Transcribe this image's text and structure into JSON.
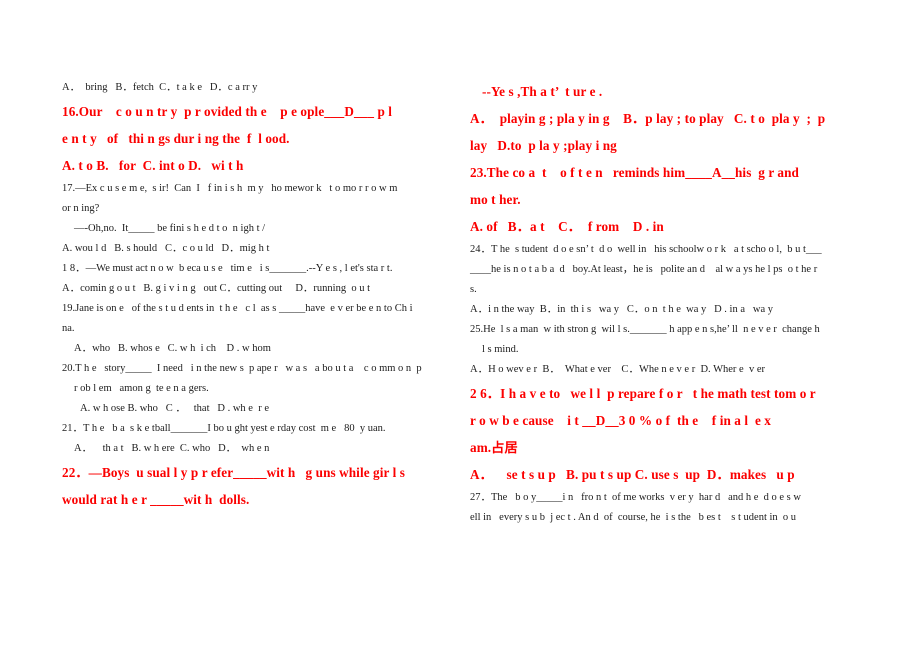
{
  "document": {
    "type": "scanned-worksheet",
    "subject": "English grammar multiple choice",
    "columns": 2,
    "colors": {
      "marked_text": "#fb0000",
      "body_text": "#1c1c1c",
      "page_background": "#ffffff"
    }
  },
  "left_column": {
    "lines": [
      {
        "id": "q15-options",
        "style": "black",
        "indent": 0,
        "text": "A．  bring   B．fetch  C．t a k e   D．c a rr y"
      },
      {
        "id": "q16-stem-1",
        "style": "red",
        "indent": 0,
        "text": "16.Our    c o u n tr y  p r ovided th e    p e ople___D___ p l"
      },
      {
        "id": "q16-stem-2",
        "style": "red",
        "indent": 0,
        "text": "e n t y   of   thi n gs dur i ng the  f  l ood."
      },
      {
        "id": "q16-options",
        "style": "red",
        "indent": 0,
        "text": "A. t o B.   for  C. int o D.   wi t h"
      },
      {
        "id": "q17-stem-1",
        "style": "black",
        "indent": 0,
        "text": "17.—Ex c u s e m e,  s ir!  Can  I   f in i s h  m y   ho mewor k   t o mo r r o w m"
      },
      {
        "id": "q17-stem-2",
        "style": "black",
        "indent": 0,
        "text": "or n ing?"
      },
      {
        "id": "q17-stem-3",
        "style": "black",
        "indent": 1,
        "text": "—-Oh,no.  It_____ be fini s h e d t o  n igh t /"
      },
      {
        "id": "q17-options",
        "style": "black",
        "indent": 0,
        "text": "A. wou l d   B. s hould   C．c o u ld   D．mig h t"
      },
      {
        "id": "q18-stem",
        "style": "black",
        "indent": 0,
        "text": "1 8．—We must act n o w  b eca u s e   tim e   i s_______.--Y e s , l et's sta r t."
      },
      {
        "id": "q18-options",
        "style": "black",
        "indent": 0,
        "text": "A．comin g o u t   B. g i v i n g   out C．cutting out     D．running  o u t"
      },
      {
        "id": "q19-stem-1",
        "style": "black",
        "indent": 0,
        "text": "19.Jane is on e   of the s t u d ents in  t h e   c l  as s _____have  e v er be e n to Ch i"
      },
      {
        "id": "q19-stem-2",
        "style": "black",
        "indent": 0,
        "text": "na."
      },
      {
        "id": "q19-options",
        "style": "black",
        "indent": 1,
        "text": "A．who   B. whos e   C. w h  i ch    D . w hom"
      },
      {
        "id": "q20-stem-1",
        "style": "black",
        "indent": 0,
        "text": "20.T h e   story_____  I need   i n the new s  p ape r   w a s   a bo u t a    c o mm o n  p"
      },
      {
        "id": "q20-stem-2",
        "style": "black",
        "indent": 1,
        "text": "r ob l em   amon g  te e n a gers."
      },
      {
        "id": "q20-options",
        "style": "black",
        "indent": 2,
        "text": "A. w h ose B. who   C ．   that   D . wh e  r e"
      },
      {
        "id": "q21-stem",
        "style": "black",
        "indent": 0,
        "text": "21．T h e   b a  s k e tball_______I bo u ght yest e rday cost  m e   80  y uan."
      },
      {
        "id": "q21-options",
        "style": "black",
        "indent": 1,
        "text": "A．    th a t   B. w h ere  C. who   D．  wh e n"
      },
      {
        "id": "q22-stem-1",
        "style": "red",
        "indent": 0,
        "text": "22．—Boys  u sual l y p r efer_____wit h   g uns while gir l s"
      },
      {
        "id": "q22-stem-2",
        "style": "red",
        "indent": 0,
        "text": "would rat h e r _____wit h  dolls."
      }
    ]
  },
  "right_column": {
    "lines": [
      {
        "id": "q22-answer",
        "style": "red",
        "indent": 1,
        "text": "--Ye s ,Th a t’  t ur e ."
      },
      {
        "id": "q22-options-1",
        "style": "red",
        "indent": 0,
        "text": "A．  playin g ; pla y in g    B．p lay ; to play   C. t o  pla y  ;  p"
      },
      {
        "id": "q22-options-2",
        "style": "red",
        "indent": 0,
        "text": "lay   D.to  p la y ;play i ng"
      },
      {
        "id": "q23-stem-1",
        "style": "red",
        "indent": 0,
        "text": "23.The co a  t    o f t e n   reminds him____A__his  g r and"
      },
      {
        "id": "q23-stem-2",
        "style": "red",
        "indent": 0,
        "text": "mo t her."
      },
      {
        "id": "q23-options",
        "style": "red",
        "indent": 0,
        "text": "A. of   B．a t    C．  f rom    D . in"
      },
      {
        "id": "q24-stem-1",
        "style": "black",
        "indent": 0,
        "text": "24．T he  s tudent  d o e sn’ t  d o  well in   his schoolw o r k   a t scho o l,  b u t___"
      },
      {
        "id": "q24-stem-2",
        "style": "black",
        "indent": 0,
        "text": "____he is n o t a b a  d   boy.At least，he is   polite an d    al w a ys he l ps  o t he r"
      },
      {
        "id": "q24-stem-3",
        "style": "black",
        "indent": 0,
        "text": "s."
      },
      {
        "id": "q24-options",
        "style": "black",
        "indent": 0,
        "text": "A．i n the way  B．in  th i s   wa y   C．o n  t h e  wa y   D . in a   wa y"
      },
      {
        "id": "q25-stem-1",
        "style": "black",
        "indent": 0,
        "text": "25.He  l s a man  w ith stron g  wil l s._______ h app e n s,he’ ll  n e v e r  change h"
      },
      {
        "id": "q25-stem-2",
        "style": "black",
        "indent": 1,
        "text": "l s mind."
      },
      {
        "id": "q25-options",
        "style": "black",
        "indent": 0,
        "text": "A．H o wev e r  B．  What e ver    C．Whe n e v e r  D. Wher e  v er"
      },
      {
        "id": "q26-stem-1",
        "style": "red",
        "indent": 0,
        "text": "2 6．I h a v e to   we l l  p repare f o r   t he math test tom o r"
      },
      {
        "id": "q26-stem-2",
        "style": "red",
        "indent": 0,
        "text": "r o w b e cause    i t __D__3 0 % o f  th e    f in a l  e x"
      },
      {
        "id": "q26-stem-3",
        "style": "red",
        "indent": 0,
        "text": "am.占居"
      },
      {
        "id": "q26-options",
        "style": "red",
        "indent": 0,
        "text": "A．    se t s u p   B. pu t s up C. use s  up  D．makes   u p"
      },
      {
        "id": "q27-stem-1",
        "style": "black",
        "indent": 0,
        "text": "27．The   b o y_____i n   fro n t  of me works  v er y  har d   and h e  d o e s w"
      },
      {
        "id": "q27-stem-2",
        "style": "black",
        "indent": 0,
        "text": "ell in   every s u b  j ec t . An d  of  course, he  i s the   b es t    s t udent in  o u"
      }
    ]
  }
}
